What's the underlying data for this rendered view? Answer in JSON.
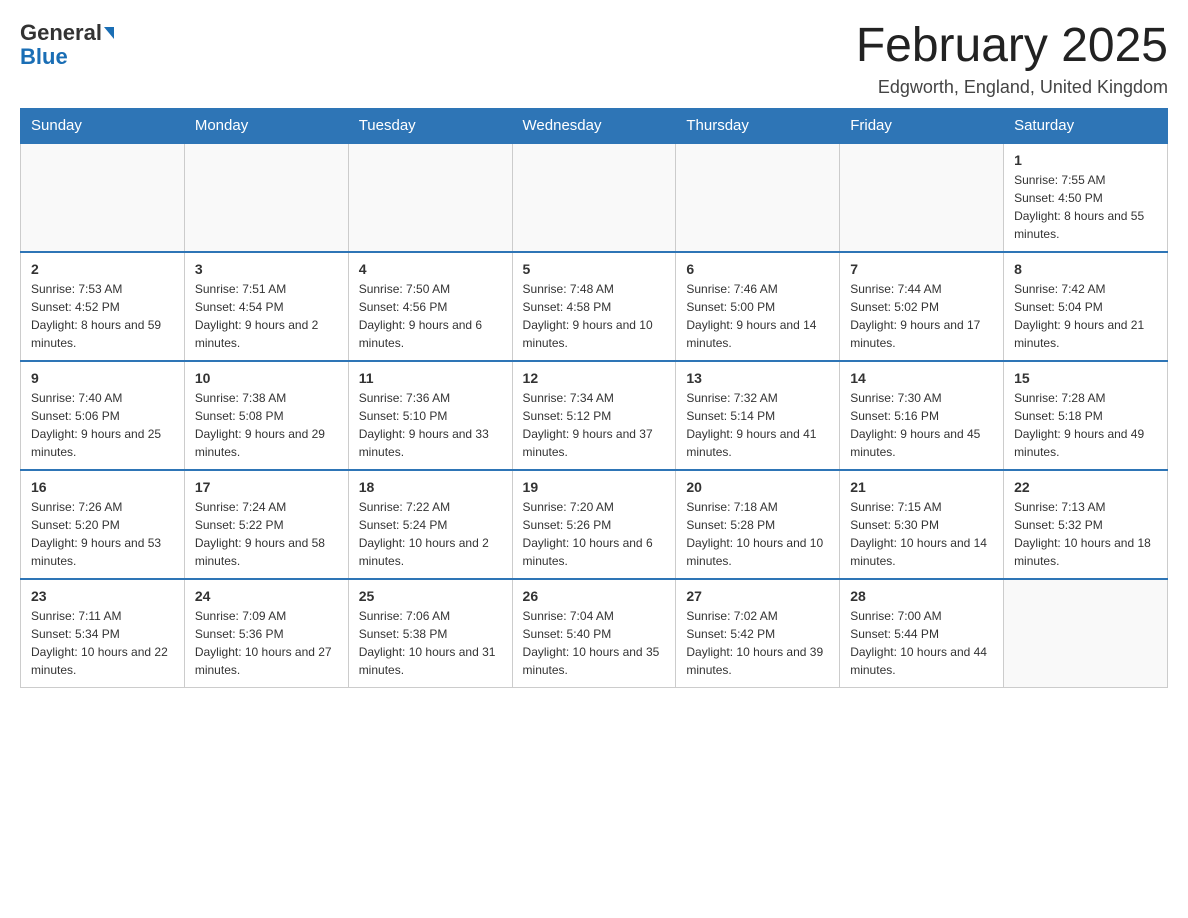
{
  "logo": {
    "general_text": "General",
    "blue_text": "Blue"
  },
  "header": {
    "title": "February 2025",
    "location": "Edgworth, England, United Kingdom"
  },
  "weekdays": [
    "Sunday",
    "Monday",
    "Tuesday",
    "Wednesday",
    "Thursday",
    "Friday",
    "Saturday"
  ],
  "weeks": [
    [
      {
        "day": "",
        "info": ""
      },
      {
        "day": "",
        "info": ""
      },
      {
        "day": "",
        "info": ""
      },
      {
        "day": "",
        "info": ""
      },
      {
        "day": "",
        "info": ""
      },
      {
        "day": "",
        "info": ""
      },
      {
        "day": "1",
        "info": "Sunrise: 7:55 AM\nSunset: 4:50 PM\nDaylight: 8 hours and 55 minutes."
      }
    ],
    [
      {
        "day": "2",
        "info": "Sunrise: 7:53 AM\nSunset: 4:52 PM\nDaylight: 8 hours and 59 minutes."
      },
      {
        "day": "3",
        "info": "Sunrise: 7:51 AM\nSunset: 4:54 PM\nDaylight: 9 hours and 2 minutes."
      },
      {
        "day": "4",
        "info": "Sunrise: 7:50 AM\nSunset: 4:56 PM\nDaylight: 9 hours and 6 minutes."
      },
      {
        "day": "5",
        "info": "Sunrise: 7:48 AM\nSunset: 4:58 PM\nDaylight: 9 hours and 10 minutes."
      },
      {
        "day": "6",
        "info": "Sunrise: 7:46 AM\nSunset: 5:00 PM\nDaylight: 9 hours and 14 minutes."
      },
      {
        "day": "7",
        "info": "Sunrise: 7:44 AM\nSunset: 5:02 PM\nDaylight: 9 hours and 17 minutes."
      },
      {
        "day": "8",
        "info": "Sunrise: 7:42 AM\nSunset: 5:04 PM\nDaylight: 9 hours and 21 minutes."
      }
    ],
    [
      {
        "day": "9",
        "info": "Sunrise: 7:40 AM\nSunset: 5:06 PM\nDaylight: 9 hours and 25 minutes."
      },
      {
        "day": "10",
        "info": "Sunrise: 7:38 AM\nSunset: 5:08 PM\nDaylight: 9 hours and 29 minutes."
      },
      {
        "day": "11",
        "info": "Sunrise: 7:36 AM\nSunset: 5:10 PM\nDaylight: 9 hours and 33 minutes."
      },
      {
        "day": "12",
        "info": "Sunrise: 7:34 AM\nSunset: 5:12 PM\nDaylight: 9 hours and 37 minutes."
      },
      {
        "day": "13",
        "info": "Sunrise: 7:32 AM\nSunset: 5:14 PM\nDaylight: 9 hours and 41 minutes."
      },
      {
        "day": "14",
        "info": "Sunrise: 7:30 AM\nSunset: 5:16 PM\nDaylight: 9 hours and 45 minutes."
      },
      {
        "day": "15",
        "info": "Sunrise: 7:28 AM\nSunset: 5:18 PM\nDaylight: 9 hours and 49 minutes."
      }
    ],
    [
      {
        "day": "16",
        "info": "Sunrise: 7:26 AM\nSunset: 5:20 PM\nDaylight: 9 hours and 53 minutes."
      },
      {
        "day": "17",
        "info": "Sunrise: 7:24 AM\nSunset: 5:22 PM\nDaylight: 9 hours and 58 minutes."
      },
      {
        "day": "18",
        "info": "Sunrise: 7:22 AM\nSunset: 5:24 PM\nDaylight: 10 hours and 2 minutes."
      },
      {
        "day": "19",
        "info": "Sunrise: 7:20 AM\nSunset: 5:26 PM\nDaylight: 10 hours and 6 minutes."
      },
      {
        "day": "20",
        "info": "Sunrise: 7:18 AM\nSunset: 5:28 PM\nDaylight: 10 hours and 10 minutes."
      },
      {
        "day": "21",
        "info": "Sunrise: 7:15 AM\nSunset: 5:30 PM\nDaylight: 10 hours and 14 minutes."
      },
      {
        "day": "22",
        "info": "Sunrise: 7:13 AM\nSunset: 5:32 PM\nDaylight: 10 hours and 18 minutes."
      }
    ],
    [
      {
        "day": "23",
        "info": "Sunrise: 7:11 AM\nSunset: 5:34 PM\nDaylight: 10 hours and 22 minutes."
      },
      {
        "day": "24",
        "info": "Sunrise: 7:09 AM\nSunset: 5:36 PM\nDaylight: 10 hours and 27 minutes."
      },
      {
        "day": "25",
        "info": "Sunrise: 7:06 AM\nSunset: 5:38 PM\nDaylight: 10 hours and 31 minutes."
      },
      {
        "day": "26",
        "info": "Sunrise: 7:04 AM\nSunset: 5:40 PM\nDaylight: 10 hours and 35 minutes."
      },
      {
        "day": "27",
        "info": "Sunrise: 7:02 AM\nSunset: 5:42 PM\nDaylight: 10 hours and 39 minutes."
      },
      {
        "day": "28",
        "info": "Sunrise: 7:00 AM\nSunset: 5:44 PM\nDaylight: 10 hours and 44 minutes."
      },
      {
        "day": "",
        "info": ""
      }
    ]
  ]
}
